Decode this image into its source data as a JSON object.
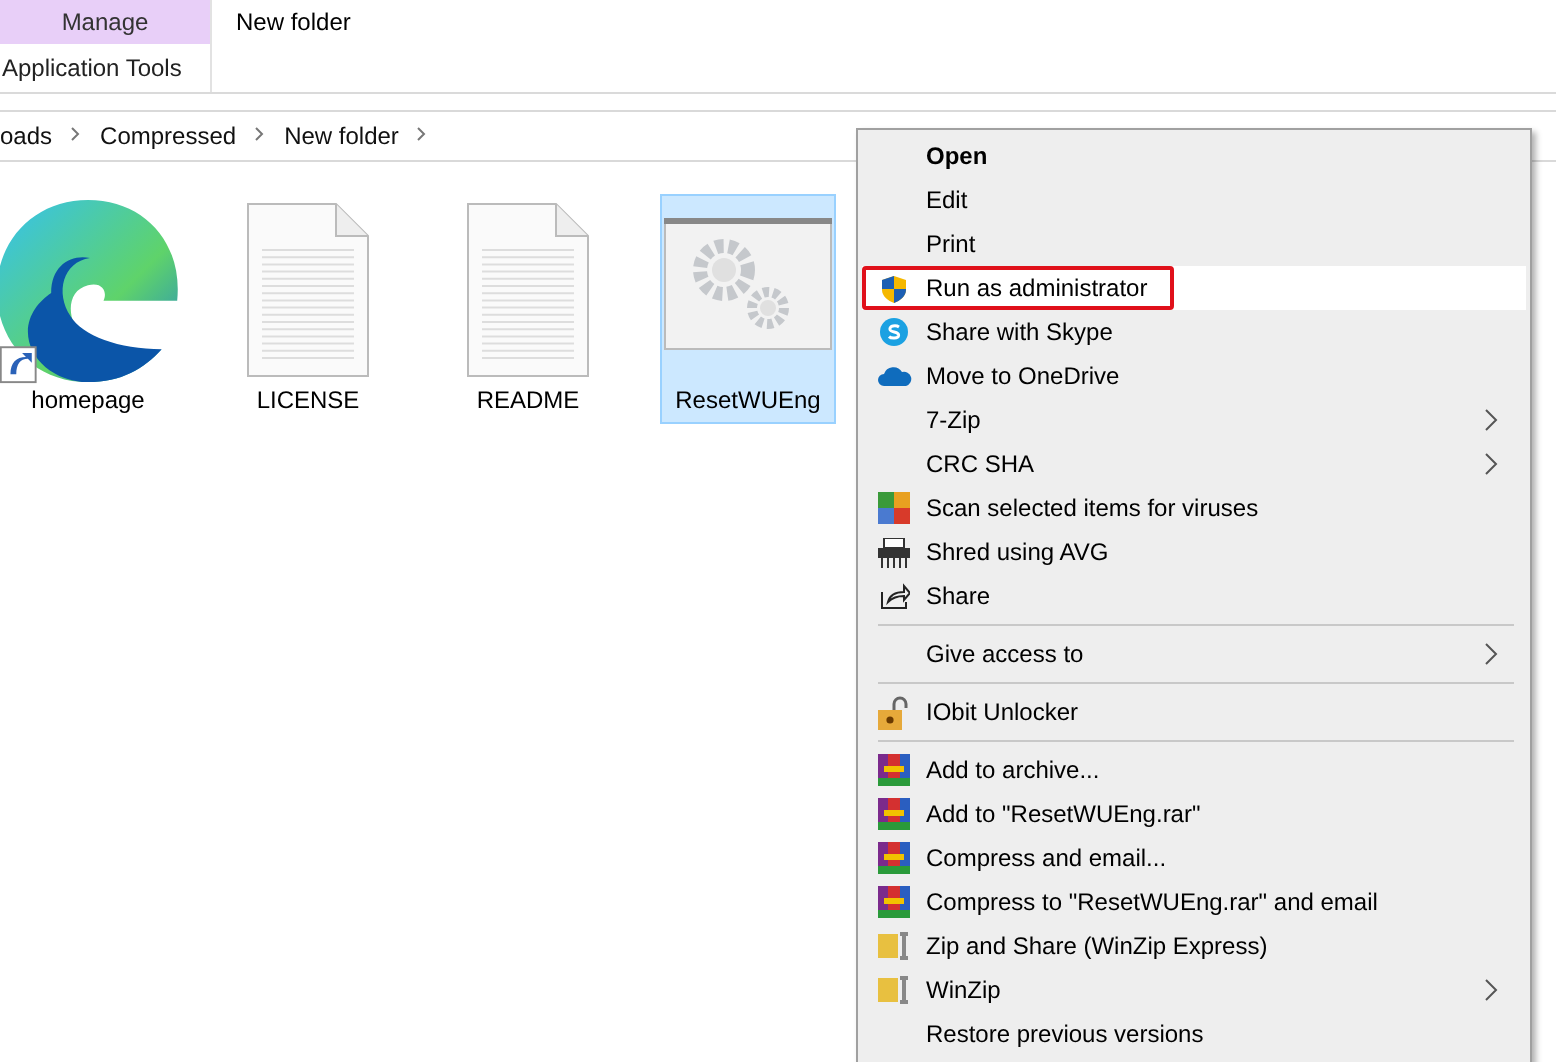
{
  "ribbon": {
    "context_tab": "Manage",
    "context_group": "Application Tools",
    "title": "New folder"
  },
  "address_bar": {
    "crumbs": [
      "oads",
      "Compressed",
      "New folder"
    ]
  },
  "files": [
    {
      "name": "homepage",
      "kind": "edge",
      "selected": false
    },
    {
      "name": "LICENSE",
      "kind": "text",
      "selected": false
    },
    {
      "name": "README",
      "kind": "text",
      "selected": false
    },
    {
      "name": "ResetWUEng",
      "kind": "app",
      "selected": true
    }
  ],
  "context_menu": [
    {
      "kind": "plain",
      "label": "Open",
      "bold": true,
      "submenu": false,
      "highlighted": false
    },
    {
      "kind": "plain",
      "label": "Edit",
      "bold": false,
      "submenu": false,
      "highlighted": false
    },
    {
      "kind": "plain",
      "label": "Print",
      "bold": false,
      "submenu": false,
      "highlighted": false
    },
    {
      "kind": "shield",
      "label": "Run as administrator",
      "bold": false,
      "submenu": false,
      "highlighted": true
    },
    {
      "kind": "skype",
      "label": "Share with Skype",
      "bold": false,
      "submenu": false,
      "highlighted": false
    },
    {
      "kind": "cloud",
      "label": "Move to OneDrive",
      "bold": false,
      "submenu": false,
      "highlighted": false
    },
    {
      "kind": "plain",
      "label": "7-Zip",
      "bold": false,
      "submenu": true,
      "highlighted": false
    },
    {
      "kind": "plain",
      "label": "CRC SHA",
      "bold": false,
      "submenu": true,
      "highlighted": false
    },
    {
      "kind": "avg",
      "label": "Scan selected items for viruses",
      "bold": false,
      "submenu": false,
      "highlighted": false
    },
    {
      "kind": "shredder",
      "label": "Shred using AVG",
      "bold": false,
      "submenu": false,
      "highlighted": false
    },
    {
      "kind": "share",
      "label": "Share",
      "bold": false,
      "submenu": false,
      "highlighted": false
    },
    {
      "kind": "separator"
    },
    {
      "kind": "plain",
      "label": "Give access to",
      "bold": false,
      "submenu": true,
      "highlighted": false
    },
    {
      "kind": "separator"
    },
    {
      "kind": "lock",
      "label": "IObit Unlocker",
      "bold": false,
      "submenu": false,
      "highlighted": false
    },
    {
      "kind": "separator"
    },
    {
      "kind": "rar",
      "label": "Add to archive...",
      "bold": false,
      "submenu": false,
      "highlighted": false
    },
    {
      "kind": "rar",
      "label": "Add to \"ResetWUEng.rar\"",
      "bold": false,
      "submenu": false,
      "highlighted": false
    },
    {
      "kind": "rar",
      "label": "Compress and email...",
      "bold": false,
      "submenu": false,
      "highlighted": false
    },
    {
      "kind": "rar",
      "label": "Compress to \"ResetWUEng.rar\" and email",
      "bold": false,
      "submenu": false,
      "highlighted": false
    },
    {
      "kind": "winzip",
      "label": "Zip and Share (WinZip Express)",
      "bold": false,
      "submenu": false,
      "highlighted": false
    },
    {
      "kind": "winzip",
      "label": "WinZip",
      "bold": false,
      "submenu": true,
      "highlighted": false
    },
    {
      "kind": "plain",
      "label": "Restore previous versions",
      "bold": false,
      "submenu": false,
      "highlighted": false
    }
  ]
}
